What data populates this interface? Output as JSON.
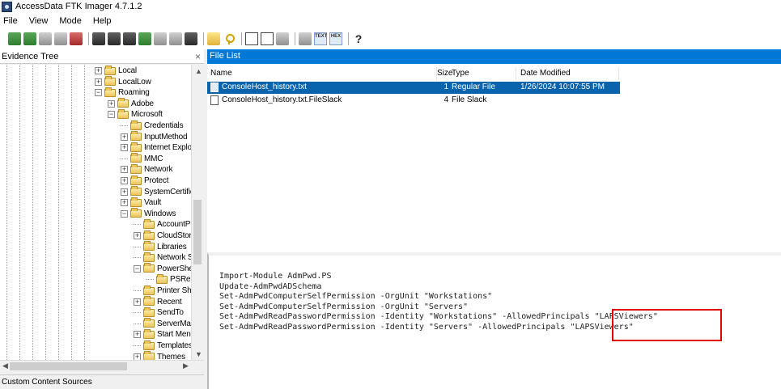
{
  "window": {
    "title": "AccessData FTK Imager 4.7.1.2"
  },
  "menu": [
    "File",
    "View",
    "Mode",
    "Help"
  ],
  "toolbar": {
    "icons": [
      "add-evidence-icon",
      "add-all-evidence-icon",
      "image-mounting-icon",
      "remove-evidence-icon",
      "remove-all-evidence-icon",
      "create-disk-image-icon",
      "export-disk-image-icon",
      "capture-memory-icon",
      "obtain-protected-files-icon",
      "detect-efs-icon",
      "export-files-icon",
      "export-hash-list-icon",
      "add-to-custom-content-icon",
      "create-custom-image-icon",
      "verify-drive-icon",
      "text-view-icon",
      "hex-view-icon",
      "help-icon"
    ],
    "text_label": "TEXT",
    "hex_label": "HEX",
    "help_label": "?"
  },
  "evidence_tree": {
    "title": "Evidence Tree",
    "close": "×",
    "nodes": [
      {
        "label": "Local",
        "expander": "+"
      },
      {
        "label": "LocalLow",
        "expander": "+"
      },
      {
        "label": "Roaming",
        "expander": "−"
      },
      {
        "label": "Adobe",
        "expander": "+"
      },
      {
        "label": "Microsoft",
        "expander": "−"
      },
      {
        "label": "Credentials",
        "expander": ""
      },
      {
        "label": "InputMethod",
        "expander": "+"
      },
      {
        "label": "Internet Explo",
        "expander": "+"
      },
      {
        "label": "MMC",
        "expander": ""
      },
      {
        "label": "Network",
        "expander": "+"
      },
      {
        "label": "Protect",
        "expander": "+"
      },
      {
        "label": "SystemCertific",
        "expander": "+"
      },
      {
        "label": "Vault",
        "expander": "+"
      },
      {
        "label": "Windows",
        "expander": "−"
      },
      {
        "label": "AccountP",
        "expander": ""
      },
      {
        "label": "CloudStor",
        "expander": "+"
      },
      {
        "label": "Libraries",
        "expander": ""
      },
      {
        "label": "Network S",
        "expander": ""
      },
      {
        "label": "PowerShe",
        "expander": "−"
      },
      {
        "label": "PSRe",
        "expander": ""
      },
      {
        "label": "Printer Sh",
        "expander": ""
      },
      {
        "label": "Recent",
        "expander": "+"
      },
      {
        "label": "SendTo",
        "expander": ""
      },
      {
        "label": "ServerMa",
        "expander": ""
      },
      {
        "label": "Start Men",
        "expander": "+"
      },
      {
        "label": "Templates",
        "expander": ""
      },
      {
        "label": "Themes",
        "expander": "+"
      }
    ]
  },
  "custom_content_sources": {
    "title": "Custom Content Sources"
  },
  "file_list": {
    "title": "File List",
    "columns": [
      "Name",
      "Size",
      "Type",
      "Date Modified"
    ],
    "rows": [
      {
        "name": "ConsoleHost_history.txt",
        "size": "1",
        "type": "Regular File",
        "modified": "1/26/2024 10:07:55 PM",
        "selected": true
      },
      {
        "name": "ConsoleHost_history.txt.FileSlack",
        "size": "4",
        "type": "File Slack",
        "modified": "",
        "selected": false
      }
    ]
  },
  "viewer": {
    "lines": [
      "Import-Module AdmPwd.PS",
      "Update-AdmPwdADSchema",
      "Set-AdmPwdComputerSelfPermission -OrgUnit \"Workstations\"",
      "Set-AdmPwdComputerSelfPermission -OrgUnit \"Servers\"",
      "Set-AdmPwdReadPasswordPermission -Identity \"Workstations\" -AllowedPrincipals \"LAPSViewers\"",
      "Set-AdmPwdReadPasswordPermission -Identity \"Servers\" -AllowedPrincipals \"LAPSViewers\""
    ],
    "highlight_color": "#e00000"
  },
  "colors": {
    "accent": "#0078d7",
    "selection": "#0a64ad"
  }
}
